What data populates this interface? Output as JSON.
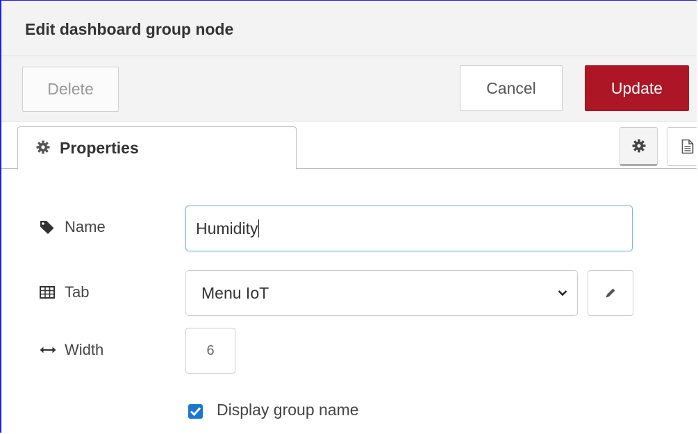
{
  "dialog": {
    "title": "Edit dashboard group node"
  },
  "toolbar": {
    "delete_label": "Delete",
    "cancel_label": "Cancel",
    "update_label": "Update"
  },
  "tabs": {
    "properties_label": "Properties",
    "icons": [
      "gear-icon",
      "document-icon"
    ]
  },
  "form": {
    "name": {
      "label": "Name",
      "value": "Humidity",
      "icon": "tag-icon"
    },
    "tab": {
      "label": "Tab",
      "value": "Menu IoT",
      "icon": "table-icon"
    },
    "width": {
      "label": "Width",
      "value": "6",
      "icon": "arrows-horizontal-icon"
    },
    "display_group_name": {
      "label": "Display group name",
      "checked": true
    }
  },
  "colors": {
    "update_button": "#ad1625",
    "checkbox": "#1976d2",
    "focus_border": "#85b7d9"
  }
}
